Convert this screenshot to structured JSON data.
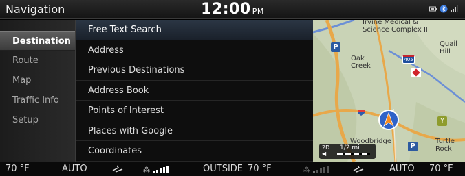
{
  "header": {
    "title": "Navigation",
    "time": "12:00",
    "ampm": "PM"
  },
  "status_icons": [
    "battery-icon",
    "bluetooth-icon",
    "signal-icon"
  ],
  "sidebar": {
    "items": [
      {
        "label": "Destination",
        "active": true
      },
      {
        "label": "Route"
      },
      {
        "label": "Map"
      },
      {
        "label": "Traffic Info"
      },
      {
        "label": "Setup"
      }
    ]
  },
  "menu": {
    "items": [
      {
        "label": "Free Text Search",
        "selected": true
      },
      {
        "label": "Address"
      },
      {
        "label": "Previous Destinations"
      },
      {
        "label": "Address Book"
      },
      {
        "label": "Points of Interest"
      },
      {
        "label": "Places with Google"
      },
      {
        "label": "Coordinates"
      }
    ]
  },
  "map": {
    "labels": {
      "irvine": "Irvine Medical &\nScience Complex II",
      "oak_creek": "Oak\nCreek",
      "quail_hill": "Quail\nHill",
      "woodbridge": "Woodbridge",
      "turtle_rock": "Turtle\nRock"
    },
    "highway_shield": "405",
    "view_mode": "2D",
    "scale": "1/2 mi",
    "colors": {
      "land": "#c9d3b6",
      "road": "#e8a84a",
      "water": "#8fb7e0"
    }
  },
  "climate": {
    "left_temp": "70 °F",
    "left_mode": "AUTO",
    "outside_label": "OUTSIDE",
    "outside_temp": "70 °F",
    "right_mode": "AUTO",
    "right_temp": "70 °F"
  }
}
